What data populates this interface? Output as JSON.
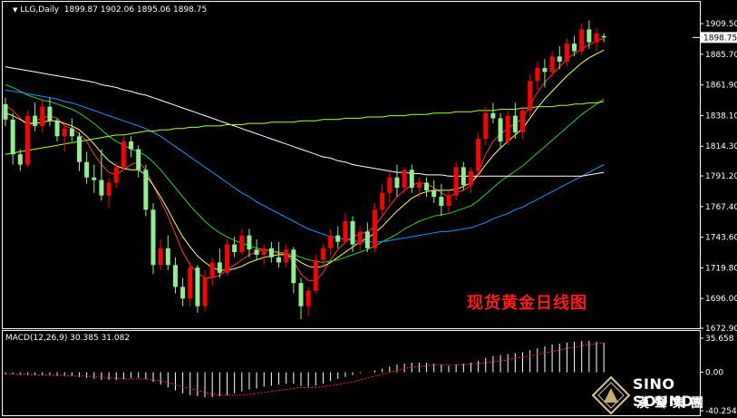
{
  "header": {
    "symbol": "LLG,Daily",
    "ohlc": "1899.87 1902.06 1895.06 1898.75"
  },
  "overlay_label": "现货黄金日线图",
  "macd_header": "MACD(12,26,9) 30.385 31.082",
  "logo": {
    "en": "SINO SOUND",
    "cn": "漢聲集團"
  },
  "colors": {
    "up": "#ff0000",
    "down": "#90ee90",
    "ma_white": "#ffffff",
    "ma_blue": "#1e90ff",
    "ma_green": "#32cd32",
    "ma_lime": "#adff2f",
    "ma_yellow": "#ffff66",
    "ma_red": "#ff3333"
  },
  "chart_data": [
    {
      "type": "candlestick",
      "ylim": [
        1672.9,
        1918
      ],
      "yticks": [
        "1909.50",
        "1885.70",
        "1861.90",
        "1838.10",
        "1814.30",
        "1791.20",
        "1767.40",
        "1743.60",
        "1719.80",
        "1696.00",
        "1672.90"
      ],
      "current_price": "1898.75",
      "candles": [
        [
          1847,
          1852,
          1830,
          1835
        ],
        [
          1835,
          1840,
          1800,
          1808
        ],
        [
          1808,
          1812,
          1795,
          1800
        ],
        [
          1800,
          1842,
          1798,
          1838
        ],
        [
          1838,
          1848,
          1826,
          1830
        ],
        [
          1830,
          1850,
          1825,
          1845
        ],
        [
          1845,
          1852,
          1830,
          1834
        ],
        [
          1834,
          1836,
          1818,
          1822
        ],
        [
          1822,
          1832,
          1810,
          1828
        ],
        [
          1828,
          1836,
          1818,
          1822
        ],
        [
          1822,
          1825,
          1795,
          1802
        ],
        [
          1802,
          1810,
          1785,
          1790
        ],
        [
          1790,
          1800,
          1778,
          1788
        ],
        [
          1788,
          1812,
          1772,
          1776
        ],
        [
          1776,
          1790,
          1766,
          1786
        ],
        [
          1786,
          1802,
          1782,
          1798
        ],
        [
          1798,
          1822,
          1796,
          1818
        ],
        [
          1818,
          1822,
          1806,
          1812
        ],
        [
          1812,
          1815,
          1790,
          1796
        ],
        [
          1796,
          1800,
          1760,
          1765
        ],
        [
          1765,
          1770,
          1715,
          1722
        ],
        [
          1722,
          1742,
          1718,
          1735
        ],
        [
          1735,
          1745,
          1718,
          1722
        ],
        [
          1722,
          1728,
          1700,
          1705
        ],
        [
          1705,
          1712,
          1690,
          1696
        ],
        [
          1696,
          1724,
          1690,
          1720
        ],
        [
          1720,
          1722,
          1685,
          1690
        ],
        [
          1690,
          1718,
          1686,
          1712
        ],
        [
          1712,
          1728,
          1706,
          1724
        ],
        [
          1724,
          1735,
          1712,
          1716
        ],
        [
          1716,
          1742,
          1714,
          1738
        ],
        [
          1738,
          1744,
          1728,
          1732
        ],
        [
          1732,
          1750,
          1730,
          1745
        ],
        [
          1745,
          1750,
          1728,
          1734
        ],
        [
          1734,
          1742,
          1726,
          1730
        ],
        [
          1730,
          1738,
          1722,
          1735
        ],
        [
          1735,
          1740,
          1724,
          1728
        ],
        [
          1728,
          1740,
          1720,
          1724
        ],
        [
          1724,
          1738,
          1720,
          1734
        ],
        [
          1734,
          1736,
          1700,
          1708
        ],
        [
          1708,
          1712,
          1680,
          1690
        ],
        [
          1690,
          1705,
          1682,
          1702
        ],
        [
          1702,
          1730,
          1700,
          1726
        ],
        [
          1726,
          1738,
          1722,
          1735
        ],
        [
          1735,
          1750,
          1730,
          1745
        ],
        [
          1745,
          1752,
          1735,
          1740
        ],
        [
          1740,
          1762,
          1738,
          1756
        ],
        [
          1756,
          1760,
          1732,
          1738
        ],
        [
          1738,
          1752,
          1732,
          1748
        ],
        [
          1748,
          1755,
          1732,
          1735
        ],
        [
          1735,
          1770,
          1732,
          1765
        ],
        [
          1765,
          1785,
          1760,
          1778
        ],
        [
          1778,
          1795,
          1770,
          1790
        ],
        [
          1790,
          1800,
          1775,
          1782
        ],
        [
          1782,
          1798,
          1778,
          1796
        ],
        [
          1796,
          1800,
          1778,
          1782
        ],
        [
          1782,
          1790,
          1775,
          1786
        ],
        [
          1786,
          1790,
          1775,
          1780
        ],
        [
          1780,
          1788,
          1770,
          1775
        ],
        [
          1775,
          1785,
          1760,
          1768
        ],
        [
          1768,
          1780,
          1762,
          1776
        ],
        [
          1776,
          1802,
          1772,
          1798
        ],
        [
          1798,
          1802,
          1780,
          1784
        ],
        [
          1784,
          1798,
          1778,
          1795
        ],
        [
          1795,
          1825,
          1790,
          1820
        ],
        [
          1820,
          1845,
          1815,
          1840
        ],
        [
          1840,
          1848,
          1832,
          1836
        ],
        [
          1836,
          1840,
          1812,
          1818
        ],
        [
          1818,
          1842,
          1815,
          1838
        ],
        [
          1838,
          1848,
          1820,
          1825
        ],
        [
          1825,
          1845,
          1820,
          1842
        ],
        [
          1842,
          1870,
          1838,
          1865
        ],
        [
          1865,
          1880,
          1858,
          1875
        ],
        [
          1875,
          1882,
          1860,
          1872
        ],
        [
          1872,
          1888,
          1868,
          1884
        ],
        [
          1884,
          1892,
          1874,
          1880
        ],
        [
          1880,
          1898,
          1876,
          1894
        ],
        [
          1894,
          1900,
          1884,
          1888
        ],
        [
          1888,
          1910,
          1885,
          1905
        ],
        [
          1905,
          1912,
          1890,
          1895
        ],
        [
          1895,
          1906,
          1888,
          1902
        ],
        [
          1899.87,
          1902.06,
          1895.06,
          1898.75
        ]
      ],
      "moving_averages": [
        {
          "color_key": "ma_red",
          "values": [
            1846,
            1842,
            1836,
            1830,
            1834,
            1836,
            1838,
            1836,
            1830,
            1828,
            1824,
            1818,
            1808,
            1800,
            1794,
            1792,
            1796,
            1800,
            1802,
            1796,
            1784,
            1772,
            1760,
            1746,
            1732,
            1722,
            1716,
            1712,
            1712,
            1714,
            1718,
            1722,
            1726,
            1730,
            1732,
            1734,
            1733,
            1731,
            1730,
            1725,
            1715,
            1710,
            1710,
            1716,
            1726,
            1734,
            1740,
            1744,
            1746,
            1748,
            1752,
            1760,
            1768,
            1775,
            1780,
            1784,
            1786,
            1785,
            1782,
            1778,
            1775,
            1778,
            1780,
            1784,
            1794,
            1808,
            1818,
            1824,
            1828,
            1832,
            1836,
            1846,
            1856,
            1864,
            1870,
            1876,
            1882,
            1886,
            1890,
            1893,
            1896,
            1898
          ]
        },
        {
          "color_key": "ma_yellow",
          "values": [
            1840,
            1838,
            1835,
            1832,
            1832,
            1833,
            1834,
            1834,
            1832,
            1830,
            1827,
            1822,
            1816,
            1809,
            1803,
            1799,
            1797,
            1796,
            1796,
            1792,
            1784,
            1775,
            1765,
            1754,
            1744,
            1736,
            1729,
            1724,
            1720,
            1718,
            1718,
            1719,
            1721,
            1724,
            1726,
            1728,
            1729,
            1730,
            1730,
            1728,
            1724,
            1721,
            1720,
            1721,
            1724,
            1728,
            1732,
            1736,
            1740,
            1743,
            1747,
            1752,
            1758,
            1764,
            1769,
            1774,
            1777,
            1779,
            1780,
            1780,
            1780,
            1781,
            1783,
            1786,
            1792,
            1800,
            1807,
            1813,
            1818,
            1823,
            1828,
            1836,
            1844,
            1851,
            1857,
            1863,
            1869,
            1874,
            1879,
            1883,
            1886,
            1889
          ]
        },
        {
          "color_key": "ma_green",
          "values": [
            1862,
            1860,
            1857,
            1854,
            1852,
            1850,
            1849,
            1847,
            1845,
            1843,
            1840,
            1836,
            1832,
            1827,
            1822,
            1818,
            1815,
            1812,
            1810,
            1807,
            1802,
            1796,
            1789,
            1782,
            1775,
            1768,
            1762,
            1756,
            1751,
            1747,
            1744,
            1741,
            1739,
            1737,
            1735,
            1734,
            1733,
            1732,
            1731,
            1730,
            1728,
            1726,
            1725,
            1724,
            1725,
            1726,
            1728,
            1730,
            1732,
            1734,
            1737,
            1740,
            1743,
            1746,
            1750,
            1753,
            1756,
            1758,
            1760,
            1761,
            1762,
            1764,
            1766,
            1768,
            1772,
            1777,
            1782,
            1787,
            1791,
            1795,
            1799,
            1804,
            1809,
            1814,
            1819,
            1824,
            1829,
            1834,
            1839,
            1843,
            1847,
            1851
          ]
        },
        {
          "color_key": "ma_blue",
          "values": [
            1858,
            1857,
            1856,
            1855,
            1854,
            1853,
            1852,
            1851,
            1849,
            1848,
            1846,
            1844,
            1842,
            1840,
            1838,
            1836,
            1834,
            1832,
            1830,
            1828,
            1825,
            1822,
            1818,
            1814,
            1810,
            1806,
            1802,
            1798,
            1794,
            1790,
            1786,
            1782,
            1778,
            1775,
            1771,
            1768,
            1765,
            1762,
            1759,
            1756,
            1753,
            1750,
            1748,
            1746,
            1744,
            1743,
            1742,
            1741,
            1740,
            1740,
            1740,
            1740,
            1741,
            1742,
            1743,
            1744,
            1745,
            1746,
            1747,
            1748,
            1748,
            1749,
            1750,
            1751,
            1753,
            1755,
            1758,
            1760,
            1762,
            1765,
            1767,
            1770,
            1773,
            1776,
            1779,
            1782,
            1785,
            1788,
            1791,
            1794,
            1797,
            1800
          ]
        },
        {
          "color_key": "ma_white",
          "values": [
            1876,
            1875,
            1874,
            1873,
            1872,
            1871,
            1870,
            1869,
            1868,
            1867,
            1866,
            1865,
            1864,
            1862,
            1861,
            1860,
            1858,
            1857,
            1855,
            1854,
            1852,
            1850,
            1848,
            1846,
            1844,
            1842,
            1840,
            1838,
            1836,
            1834,
            1832,
            1830,
            1828,
            1826,
            1824,
            1822,
            1820,
            1818,
            1816,
            1814,
            1812,
            1810,
            1808,
            1806,
            1805,
            1803,
            1802,
            1800,
            1799,
            1798,
            1797,
            1796,
            1795,
            1794,
            1794,
            1793,
            1793,
            1792,
            1792,
            1792,
            1791,
            1791,
            1791,
            1791,
            1791,
            1791,
            1791,
            1791,
            1791,
            1791,
            1791,
            1791,
            1791,
            1791,
            1791,
            1791,
            1791,
            1791,
            1791,
            1792,
            1793,
            1794
          ]
        },
        {
          "color_key": "ma_lime",
          "values": [
            1808,
            1809,
            1810,
            1811,
            1812,
            1813,
            1814,
            1815,
            1816,
            1817,
            1818,
            1819,
            1820,
            1821,
            1822,
            1823,
            1823,
            1824,
            1825,
            1826,
            1826,
            1827,
            1827,
            1828,
            1828,
            1829,
            1829,
            1830,
            1830,
            1830,
            1831,
            1831,
            1831,
            1832,
            1832,
            1832,
            1833,
            1833,
            1833,
            1833,
            1834,
            1834,
            1834,
            1835,
            1835,
            1835,
            1836,
            1836,
            1836,
            1837,
            1837,
            1837,
            1838,
            1838,
            1838,
            1839,
            1839,
            1839,
            1840,
            1840,
            1840,
            1841,
            1841,
            1841,
            1842,
            1842,
            1842,
            1843,
            1843,
            1843,
            1844,
            1844,
            1845,
            1845,
            1845,
            1846,
            1846,
            1847,
            1847,
            1848,
            1848,
            1849
          ]
        }
      ]
    },
    {
      "type": "macd",
      "ylim": [
        -40.254,
        35.658
      ],
      "yticks": [
        "35.658",
        "0.00",
        "-40.254"
      ],
      "histogram": [
        -2,
        -2,
        -3,
        -3,
        -3,
        -3,
        -3,
        -4,
        -4,
        -4,
        -5,
        -6,
        -7,
        -8,
        -8,
        -8,
        -7,
        -6,
        -6,
        -7,
        -10,
        -13,
        -16,
        -19,
        -22,
        -24,
        -25,
        -26,
        -26,
        -25,
        -24,
        -22,
        -20,
        -18,
        -17,
        -15,
        -14,
        -13,
        -12,
        -12,
        -14,
        -15,
        -14,
        -12,
        -9,
        -7,
        -5,
        -3,
        -1,
        0,
        2,
        4,
        6,
        8,
        9,
        10,
        10,
        10,
        9,
        8,
        7,
        8,
        9,
        10,
        12,
        15,
        17,
        18,
        19,
        20,
        21,
        23,
        25,
        27,
        29,
        30,
        31,
        32,
        33,
        33,
        32,
        31
      ],
      "signal": [
        -2,
        -2,
        -2,
        -2,
        -3,
        -3,
        -3,
        -3,
        -3,
        -4,
        -4,
        -4,
        -5,
        -5,
        -6,
        -6,
        -7,
        -7,
        -7,
        -7,
        -8,
        -9,
        -11,
        -13,
        -15,
        -17,
        -19,
        -21,
        -23,
        -24,
        -24,
        -24,
        -24,
        -23,
        -22,
        -21,
        -20,
        -19,
        -18,
        -17,
        -16,
        -16,
        -16,
        -15,
        -14,
        -13,
        -11,
        -10,
        -8,
        -6,
        -4,
        -2,
        0,
        2,
        4,
        5,
        6,
        7,
        8,
        8,
        8,
        8,
        8,
        9,
        9,
        10,
        11,
        12,
        13,
        15,
        16,
        17,
        19,
        20,
        22,
        23,
        25,
        26,
        28,
        29,
        30,
        31
      ]
    }
  ]
}
